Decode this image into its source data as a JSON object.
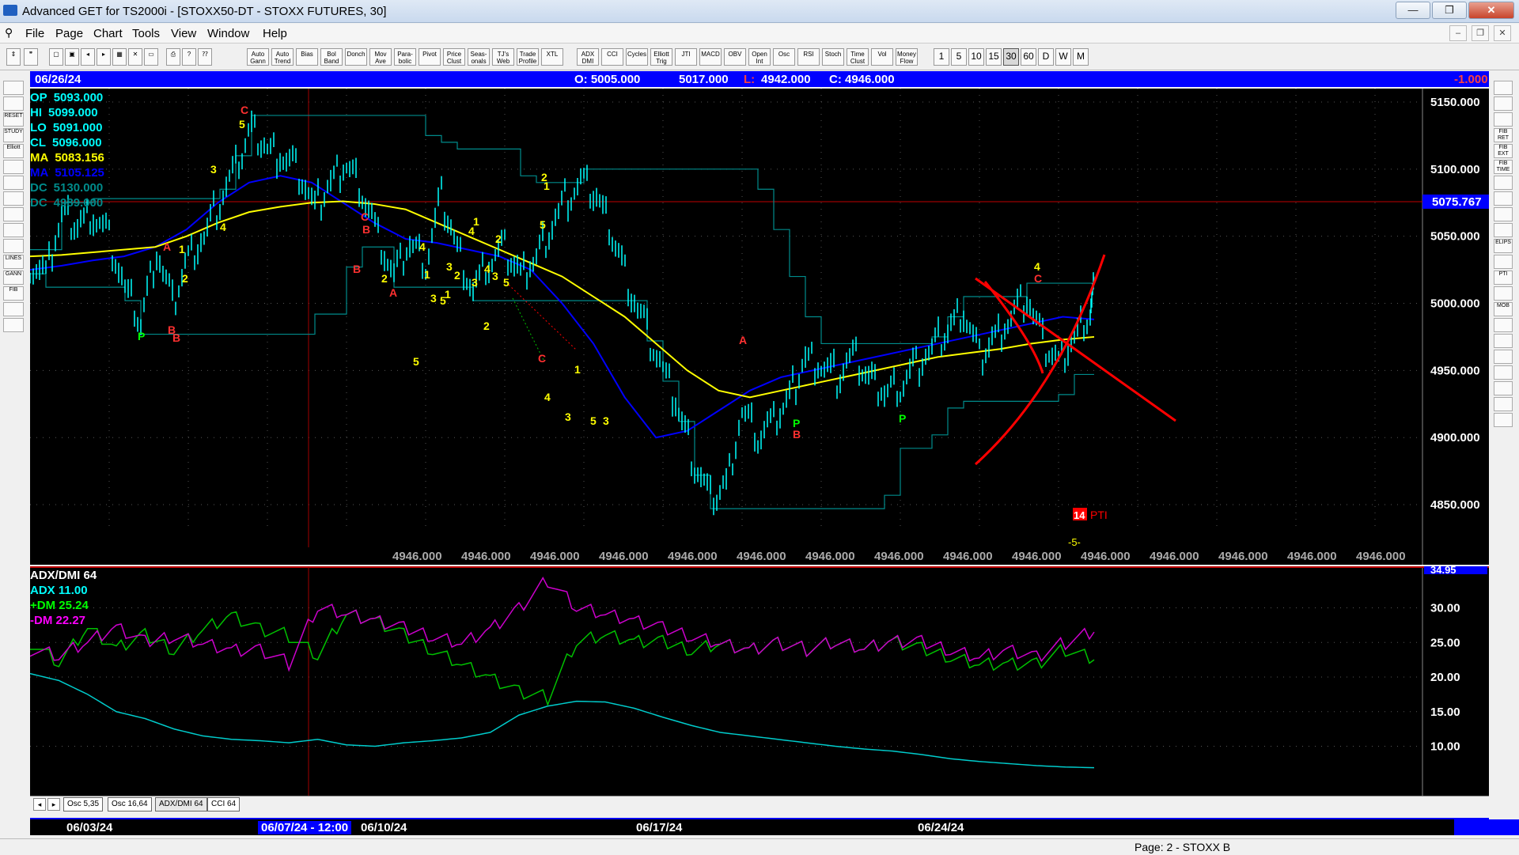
{
  "window": {
    "title": "Advanced GET for TS2000i - [STOXX50-DT - STOXX FUTURES, 30]",
    "controls": {
      "minimize": "—",
      "maximize": "❐",
      "close": "✕"
    }
  },
  "menu": [
    "File",
    "Page",
    "Chart",
    "Tools",
    "View",
    "Window",
    "Help"
  ],
  "toolbar": {
    "studies": [
      "Auto Gann",
      "Auto Trend",
      "Bias",
      "Bol Band",
      "Donch",
      "Mov Ave",
      "Para-bolic",
      "Pivot",
      "Price Clust",
      "Seas-onals",
      "TJ's Web",
      "Trade Profile",
      "XTL"
    ],
    "indicators": [
      "ADX DMI",
      "CCI",
      "Cycles",
      "Elliott Trig",
      "JTI",
      "MACD",
      "OBV",
      "Open Int",
      "Osc",
      "RSI",
      "Stoch",
      "Time Clust",
      "Vol",
      "Money Flow"
    ],
    "periods": [
      "1",
      "5",
      "10",
      "15",
      "30",
      "60",
      "D",
      "W",
      "M"
    ],
    "active_period": "30"
  },
  "left_tools": [
    "",
    "",
    "RESET",
    "STUDY",
    "Elliott",
    "",
    "",
    "",
    "",
    "",
    "",
    "LINES",
    "GANN",
    "FIB",
    "",
    ""
  ],
  "right_tools": [
    "",
    "",
    "",
    "FIB RET",
    "FIB EXT",
    "FIB TIME",
    "",
    "",
    "",
    "",
    "ELIPS",
    "",
    "PTI",
    "",
    "MOB",
    "",
    "",
    "",
    "",
    "",
    "",
    ""
  ],
  "infobar": {
    "date": "06/26/24",
    "open": "O: 5005.000",
    "high": "5017.000",
    "low_label": "L:",
    "low": "4942.000",
    "close": "C: 4946.000",
    "change": "-1.000"
  },
  "main_chart": {
    "readouts": [
      {
        "label": "OP",
        "value": "5093.000",
        "color": "#00ffff"
      },
      {
        "label": "HI",
        "value": "5099.000",
        "color": "#00ffff"
      },
      {
        "label": "LO",
        "value": "5091.000",
        "color": "#00ffff"
      },
      {
        "label": "CL",
        "value": "5096.000",
        "color": "#00ffff"
      },
      {
        "label": "MA",
        "value": "5083.156",
        "color": "#ffff00"
      },
      {
        "label": "MA",
        "value": "5105.125",
        "color": "#0000ff"
      },
      {
        "label": "DC",
        "value": "5130.000",
        "color": "#008b8b"
      },
      {
        "label": "DC",
        "value": "4989.000",
        "color": "#008b8b"
      }
    ],
    "price_axis": [
      "5150.000",
      "5100.000",
      "5050.000",
      "5000.000",
      "4950.000",
      "4900.000",
      "4850.000"
    ],
    "current_price_label": "5075.767",
    "bottom_labels": [
      "4946.000",
      "4946.000",
      "4946.000",
      "4946.000",
      "4946.000",
      "4946.000",
      "4946.000",
      "4946.000",
      "4946.000",
      "4946.000",
      "4946.000",
      "4946.000",
      "4946.000",
      "4946.000",
      "4946.000"
    ],
    "pti_value": "14",
    "pti_label": "PTI",
    "projection_label": "-5-",
    "wave_labels": [
      "C",
      "5",
      "3",
      "4",
      "A",
      "1",
      "2",
      "B",
      "P",
      "B",
      "C",
      "B",
      "A",
      "B",
      "2",
      "4",
      "1",
      "3",
      "5",
      "3",
      "4",
      "1",
      "2",
      "3",
      "5",
      "C",
      "5",
      "2",
      "1",
      "4",
      "2",
      "3",
      "5",
      "1",
      "2",
      "1",
      "4",
      "3",
      "5",
      "3",
      "A",
      "P",
      "B",
      "P",
      "4",
      "C"
    ]
  },
  "chart_data": {
    "type": "line",
    "ylim": [
      4830,
      5160
    ],
    "series": [],
    "x": [
      0,
      20,
      40,
      60,
      80,
      100,
      120,
      140,
      160,
      180,
      200,
      220,
      240,
      260,
      280,
      300,
      320,
      340,
      360,
      380,
      400,
      420,
      440,
      460,
      480,
      500,
      520,
      540,
      560,
      580,
      600,
      620,
      640,
      660,
      680,
      700,
      720,
      740,
      760,
      780,
      800,
      820,
      840,
      860,
      880,
      900,
      920,
      940,
      960,
      980,
      1000,
      1020,
      1040,
      1060,
      1080,
      1100,
      1120,
      1140,
      1160,
      1180,
      1200,
      1220,
      1240,
      1260,
      1280,
      1300,
      1320,
      1340,
      1345
    ],
    "price": [
      5030,
      5020,
      5065,
      5060,
      5068,
      5050,
      5010,
      4985,
      5040,
      5000,
      5035,
      5050,
      5075,
      5100,
      5130,
      5115,
      5110,
      5098,
      5070,
      5090,
      5105,
      5085,
      5050,
      5020,
      5045,
      5030,
      5080,
      5040,
      5010,
      5030,
      5040,
      5020,
      5035,
      5060,
      5080,
      5090,
      5075,
      5045,
      5010,
      4980,
      4950,
      4920,
      4880,
      4855,
      4865,
      4920,
      4900,
      4910,
      4930,
      4960,
      4955,
      4945,
      4960,
      4945,
      4935,
      4940,
      4955,
      4965,
      4980,
      4995,
      4960,
      4975,
      4990,
      5005,
      4970,
      4955,
      4975,
      4995,
      5010
    ],
    "ma_yellow": [
      5035,
      5036,
      5038,
      5040,
      5042,
      5050,
      5060,
      5068,
      5072,
      5075,
      5076,
      5074,
      5070,
      5060,
      5050,
      5040,
      5030,
      5020,
      5005,
      4990,
      4970,
      4950,
      4935,
      4930,
      4935,
      4940,
      4945,
      4950,
      4955,
      4960,
      4963,
      4966,
      4970,
      4973,
      4975
    ],
    "ma_blue": [
      5025,
      5028,
      5032,
      5035,
      5042,
      5055,
      5075,
      5090,
      5095,
      5090,
      5075,
      5060,
      5048,
      5045,
      5040,
      5035,
      5025,
      5000,
      4970,
      4930,
      4900,
      4905,
      4920,
      4935,
      4945,
      4950,
      4955,
      4960,
      4965,
      4970,
      4975,
      4980,
      4985,
      4990,
      4988
    ],
    "adx": [
      20.5,
      19.5,
      17.5,
      15.0,
      14.0,
      12.5,
      11.5,
      11.0,
      10.8,
      10.5,
      11.0,
      10.2,
      10.0,
      10.5,
      10.8,
      11.2,
      12.0,
      14.5,
      15.8,
      16.5,
      16.4,
      15.5,
      14.2,
      13.0,
      12.0,
      11.5,
      11.0,
      10.5,
      10.0,
      9.6,
      9.3,
      8.8,
      8.2,
      7.8,
      7.5,
      7.2,
      7.0,
      6.9
    ],
    "plus_dm": [
      25,
      22,
      27,
      24,
      26,
      24,
      27,
      29,
      27,
      26,
      23,
      29,
      28,
      26,
      24,
      22,
      20,
      18,
      17,
      25,
      26,
      25,
      25,
      24,
      25,
      24,
      25,
      24,
      25,
      24,
      25,
      24,
      23,
      22,
      22,
      22,
      24,
      22.5
    ],
    "minus_dm": [
      24,
      23,
      25,
      27,
      25,
      26,
      25,
      24,
      24,
      22,
      30,
      29,
      28,
      27,
      26,
      25,
      27,
      30,
      34,
      30,
      29,
      28,
      27,
      26,
      25,
      24,
      25,
      24,
      25,
      24,
      25,
      25,
      24,
      23,
      24,
      23,
      25,
      26.5
    ],
    "lower_axis": [
      "30.00",
      "25.00",
      "20.00",
      "15.00",
      "10.00"
    ],
    "lower_top_value": "34.95"
  },
  "lower_chart": {
    "readouts": [
      {
        "label": "ADX/DMI 64",
        "color": "#ffffff"
      },
      {
        "label": "ADX 11.00",
        "color": "#00ffff"
      },
      {
        "label": "+DM 25.24",
        "color": "#00ff00"
      },
      {
        "label": "-DM 22.27",
        "color": "#ff00ff"
      }
    ]
  },
  "tabs": [
    "Osc 5,35",
    "Osc 16,64",
    "ADX/DMI 64",
    "CCI 64"
  ],
  "active_tab": "ADX/DMI 64",
  "date_axis": {
    "labels": [
      "06/03/24",
      "06/10/24",
      "06/17/24",
      "06/24/24"
    ],
    "cursor_label": "06/07/24 - 12:00"
  },
  "status": {
    "text": "Page: 2 - STOXX B"
  },
  "colors": {
    "price": "#00ffff",
    "ma_fast": "#ffff00",
    "ma_slow": "#0000ff",
    "channel": "#008b8b",
    "trend": "#ff0000",
    "background": "#000000",
    "infobar": "#0000ff"
  }
}
